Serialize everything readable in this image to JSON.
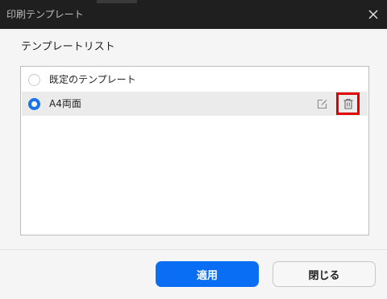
{
  "window": {
    "title": "印刷テンプレート"
  },
  "section": {
    "label": "テンプレートリスト"
  },
  "templates": {
    "items": [
      {
        "label": "既定のテンプレート",
        "selected": false
      },
      {
        "label": "A4両面",
        "selected": true
      }
    ]
  },
  "footer": {
    "apply_label": "適用",
    "close_label": "閉じる"
  },
  "colors": {
    "accent": "#0a6ef5",
    "highlight": "#e00000",
    "titlebar": "#1f1f1f"
  },
  "icons": {
    "close": "close-icon",
    "edit": "edit-icon",
    "delete": "trash-icon"
  }
}
